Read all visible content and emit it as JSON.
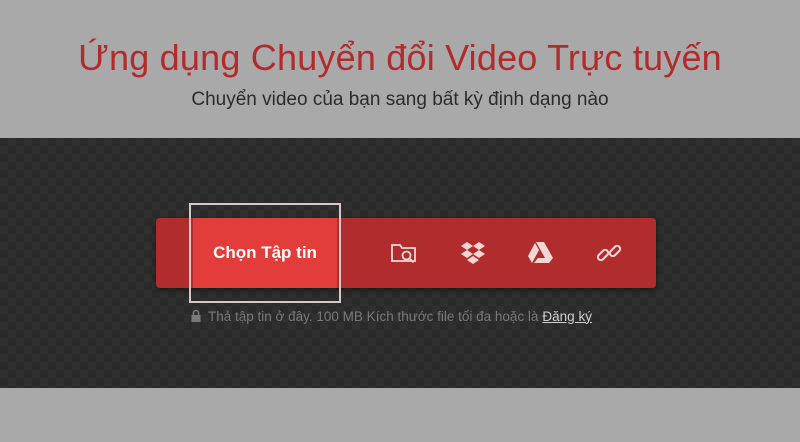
{
  "header": {
    "title": "Ứng dụng Chuyển đổi Video Trực tuyến",
    "subtitle": "Chuyển video của bạn sang bất kỳ định dạng nào"
  },
  "upload": {
    "choose_label": "Chọn Tập tin",
    "sources": [
      {
        "icon": "folder-search-icon"
      },
      {
        "icon": "dropbox-icon"
      },
      {
        "icon": "google-drive-icon"
      },
      {
        "icon": "link-icon"
      }
    ],
    "note_text": "Thả tập tin ở đây. 100 MB Kích thước file tối đa hoặc là",
    "signup_label": "Đăng ký"
  },
  "colors": {
    "title": "#b22a2a",
    "bar": "#b12d2d",
    "button": "#e23d3a",
    "background": "#a9a9a9",
    "drop_zone": "#2a2a2a"
  }
}
